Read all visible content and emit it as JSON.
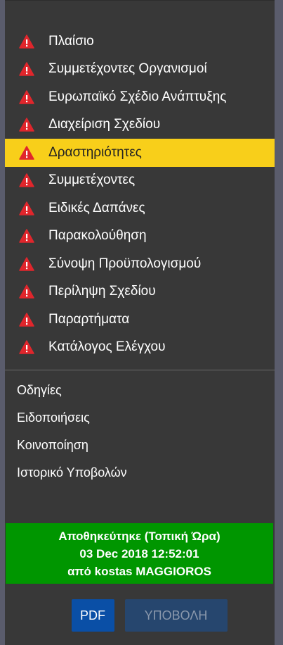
{
  "colors": {
    "panel_bg": "#383838",
    "active_bg": "#f8cf1a",
    "warning_icon": "#e0262c",
    "saved_bg": "#009600",
    "pdf_button": "#0a4fa6",
    "submit_button_disabled": "#26466e"
  },
  "nav": {
    "items": [
      {
        "label": "Πλαίσιο",
        "icon": "warning-icon",
        "active": false
      },
      {
        "label": "Συμμετέχοντες Οργανισμοί",
        "icon": "warning-icon",
        "active": false
      },
      {
        "label": "Ευρωπαϊκό Σχέδιο Ανάπτυξης",
        "icon": "warning-icon",
        "active": false
      },
      {
        "label": "Διαχείριση Σχεδίου",
        "icon": "warning-icon",
        "active": false
      },
      {
        "label": "Δραστηριότητες",
        "icon": "warning-icon",
        "active": true
      },
      {
        "label": "Συμμετέχοντες",
        "icon": "warning-icon",
        "active": false
      },
      {
        "label": "Ειδικές Δαπάνες",
        "icon": "warning-icon",
        "active": false
      },
      {
        "label": "Παρακολούθηση",
        "icon": "warning-icon",
        "active": false
      },
      {
        "label": "Σύνοψη Προϋπολογισμού",
        "icon": "warning-icon",
        "active": false
      },
      {
        "label": "Περίληψη Σχεδίου",
        "icon": "warning-icon",
        "active": false
      },
      {
        "label": "Παραρτήματα",
        "icon": "warning-icon",
        "active": false
      },
      {
        "label": "Κατάλογος Ελέγχου",
        "icon": "warning-icon",
        "active": false
      }
    ]
  },
  "links": {
    "items": [
      {
        "label": "Οδηγίες"
      },
      {
        "label": "Ειδοποιήσεις"
      },
      {
        "label": "Κοινοποίηση"
      },
      {
        "label": "Ιστορικό Υποβολών"
      }
    ]
  },
  "saved": {
    "line1": "Αποθηκεύτηκε (Τοπική Ώρα)",
    "line2": "03 Dec 2018 12:52:01",
    "line3": "από kostas MAGGIOROS"
  },
  "buttons": {
    "pdf_label": "PDF",
    "submit_label": "ΥΠΟΒΟΛΗ"
  }
}
